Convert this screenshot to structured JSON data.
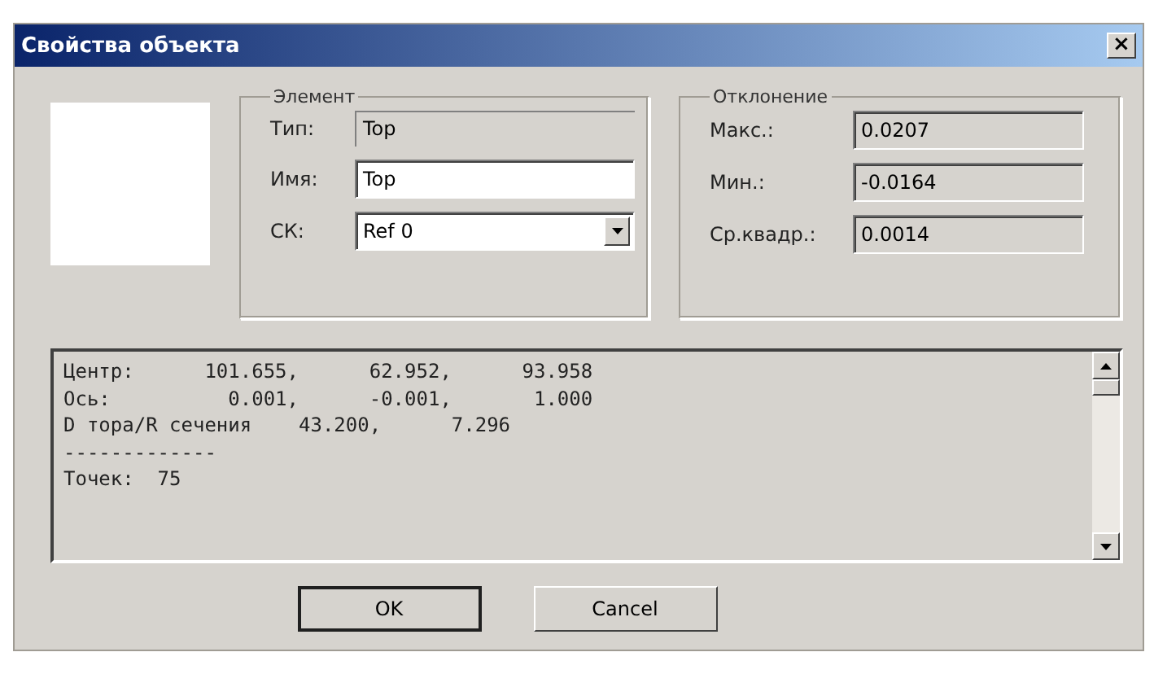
{
  "window": {
    "title": "Свойства объекта",
    "close": "×"
  },
  "element": {
    "legend": "Элемент",
    "fields": [
      {
        "kind": "readonly",
        "label": "Тип:",
        "value": "Top"
      },
      {
        "kind": "input",
        "label": "Имя:",
        "value": "Top"
      },
      {
        "kind": "select",
        "label": "СК:",
        "value": "Ref 0"
      }
    ]
  },
  "deviation": {
    "legend": "Отклонение",
    "fields": [
      {
        "label": "Макс.:",
        "value": "0.0207"
      },
      {
        "label": "Мин.:",
        "value": "-0.0164"
      },
      {
        "label": "Ср.квадр.:",
        "value": "0.0014"
      }
    ]
  },
  "report": {
    "lines": [
      "Центр:      101.655,      62.952,      93.958",
      "Ось:          0.001,      -0.001,       1.000",
      "D тора/R сечения    43.200,      7.296",
      "-------------",
      "Точек:  75"
    ]
  },
  "buttons": [
    "OK",
    "Cancel"
  ]
}
